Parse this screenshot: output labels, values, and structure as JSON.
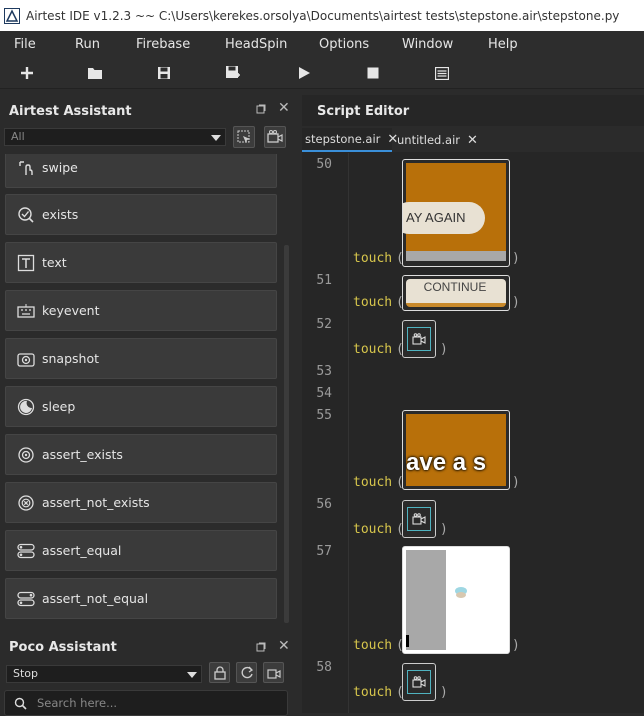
{
  "window": {
    "title": "Airtest IDE v1.2.3 ~~ C:\\Users\\kerekes.orsolya\\Documents\\airtest tests\\stepstone.air\\stepstone.py"
  },
  "menu": [
    "File",
    "Run",
    "Firebase",
    "HeadSpin",
    "Options",
    "Window",
    "Help"
  ],
  "toolbar": {
    "icons": [
      "plus-icon",
      "folder-open-icon",
      "save-icon",
      "save-all-icon",
      "play-icon",
      "stop-icon",
      "log-list-icon"
    ]
  },
  "assistant": {
    "title": "Airtest Assistant",
    "filter_value": "All",
    "items": [
      {
        "label": "swipe",
        "icon": "swipe-icon"
      },
      {
        "label": "exists",
        "icon": "exists-icon"
      },
      {
        "label": "text",
        "icon": "text-icon"
      },
      {
        "label": "keyevent",
        "icon": "keyboard-icon"
      },
      {
        "label": "snapshot",
        "icon": "snapshot-icon"
      },
      {
        "label": "sleep",
        "icon": "sleep-icon"
      },
      {
        "label": "assert_exists",
        "icon": "assert-exists-icon"
      },
      {
        "label": "assert_not_exists",
        "icon": "assert-not-exists-icon"
      },
      {
        "label": "assert_equal",
        "icon": "assert-equal-icon"
      },
      {
        "label": "assert_not_equal",
        "icon": "assert-not-equal-icon"
      }
    ]
  },
  "poco": {
    "title": "Poco Assistant",
    "mode_value": "Stop",
    "search_placeholder": "Search here..."
  },
  "editor": {
    "title": "Script Editor",
    "tabs": [
      {
        "label": "stepstone.air",
        "active": true
      },
      {
        "label": "untitled.air",
        "active": false
      }
    ],
    "lines": [
      {
        "num": "50",
        "code": "touch",
        "image_text": "AY AGAIN"
      },
      {
        "num": "51",
        "code": "touch",
        "image_text": "CONTINUE"
      },
      {
        "num": "52",
        "code": "touch",
        "image_text": ""
      },
      {
        "num": "53",
        "code": "",
        "image_text": ""
      },
      {
        "num": "54",
        "code": "",
        "image_text": ""
      },
      {
        "num": "55",
        "code": "touch",
        "image_text": "ave a s"
      },
      {
        "num": "56",
        "code": "touch",
        "image_text": ""
      },
      {
        "num": "57",
        "code": "touch",
        "image_text": ""
      },
      {
        "num": "58",
        "code": "touch",
        "image_text": ""
      }
    ]
  },
  "colors": {
    "accent": "#3a8fd9",
    "keyword": "#d7c64c",
    "thumb_orange": "#b8700a"
  }
}
